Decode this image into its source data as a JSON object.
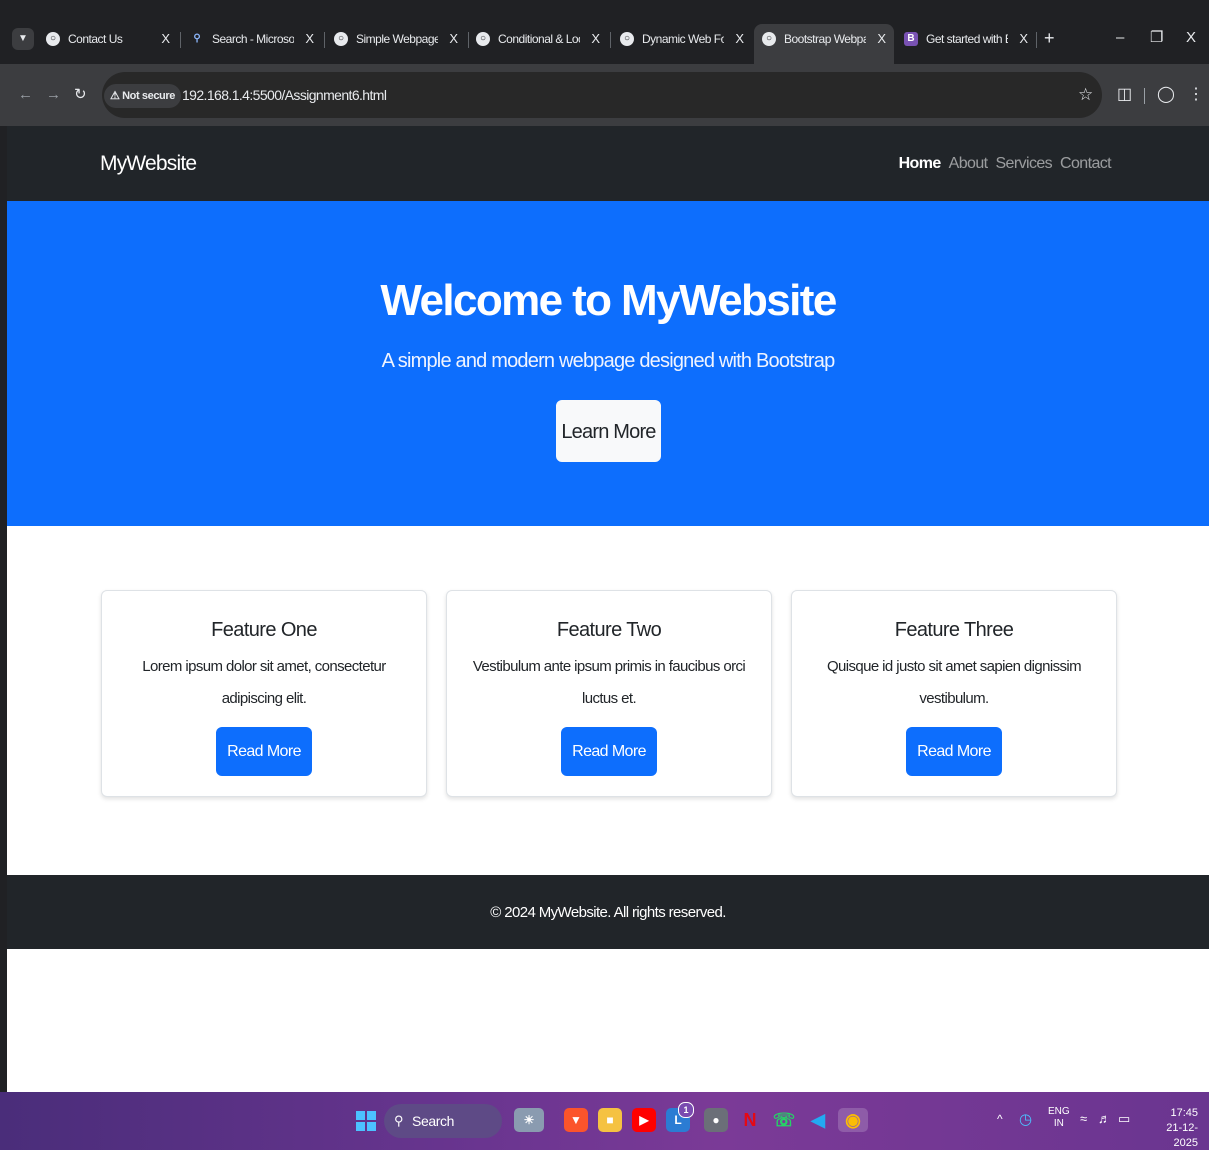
{
  "browser": {
    "tabs": [
      {
        "label": "Contact Us",
        "icon": "globe-icon"
      },
      {
        "label": "Search - Microsoft Bi",
        "icon": "search-icon"
      },
      {
        "label": "Simple Webpage Des",
        "icon": "globe-icon"
      },
      {
        "label": "Conditional & Loopi",
        "icon": "globe-icon"
      },
      {
        "label": "Dynamic Web Form",
        "icon": "globe-icon"
      },
      {
        "label": "Bootstrap Webpage",
        "icon": "globe-icon"
      },
      {
        "label": "Get started with Boo",
        "icon": "bootstrap-icon"
      }
    ],
    "active_tab": 5,
    "close_glyph": "X",
    "new_tab_glyph": "+",
    "security_label": "Not secure",
    "url": "192.168.1.4:5500/Assignment6.html"
  },
  "site": {
    "brand": "MyWebsite",
    "nav": [
      "Home",
      "About",
      "Services",
      "Contact"
    ],
    "hero": {
      "title": "Welcome to MyWebsite",
      "subtitle": "A simple and modern webpage designed with Bootstrap",
      "button": "Learn More"
    },
    "features": [
      {
        "title": "Feature One",
        "text": "Lorem ipsum dolor sit amet, consectetur adipiscing elit.",
        "button": "Read More"
      },
      {
        "title": "Feature Two",
        "text": "Vestibulum ante ipsum primis in faucibus orci luctus et.",
        "button": "Read More"
      },
      {
        "title": "Feature Three",
        "text": "Quisque id justo sit amet sapien dignissim vestibulum.",
        "button": "Read More"
      }
    ],
    "footer": "© 2024 MyWebsite. All rights reserved."
  },
  "taskbar": {
    "search_label": "Search",
    "lang_top": "ENG",
    "lang_bottom": "IN",
    "time": "17:45",
    "date": "21-12-2025",
    "badge": "1"
  },
  "colors": {
    "primary": "#0d6efd",
    "dark": "#212529",
    "browser_frame": "#202124"
  }
}
